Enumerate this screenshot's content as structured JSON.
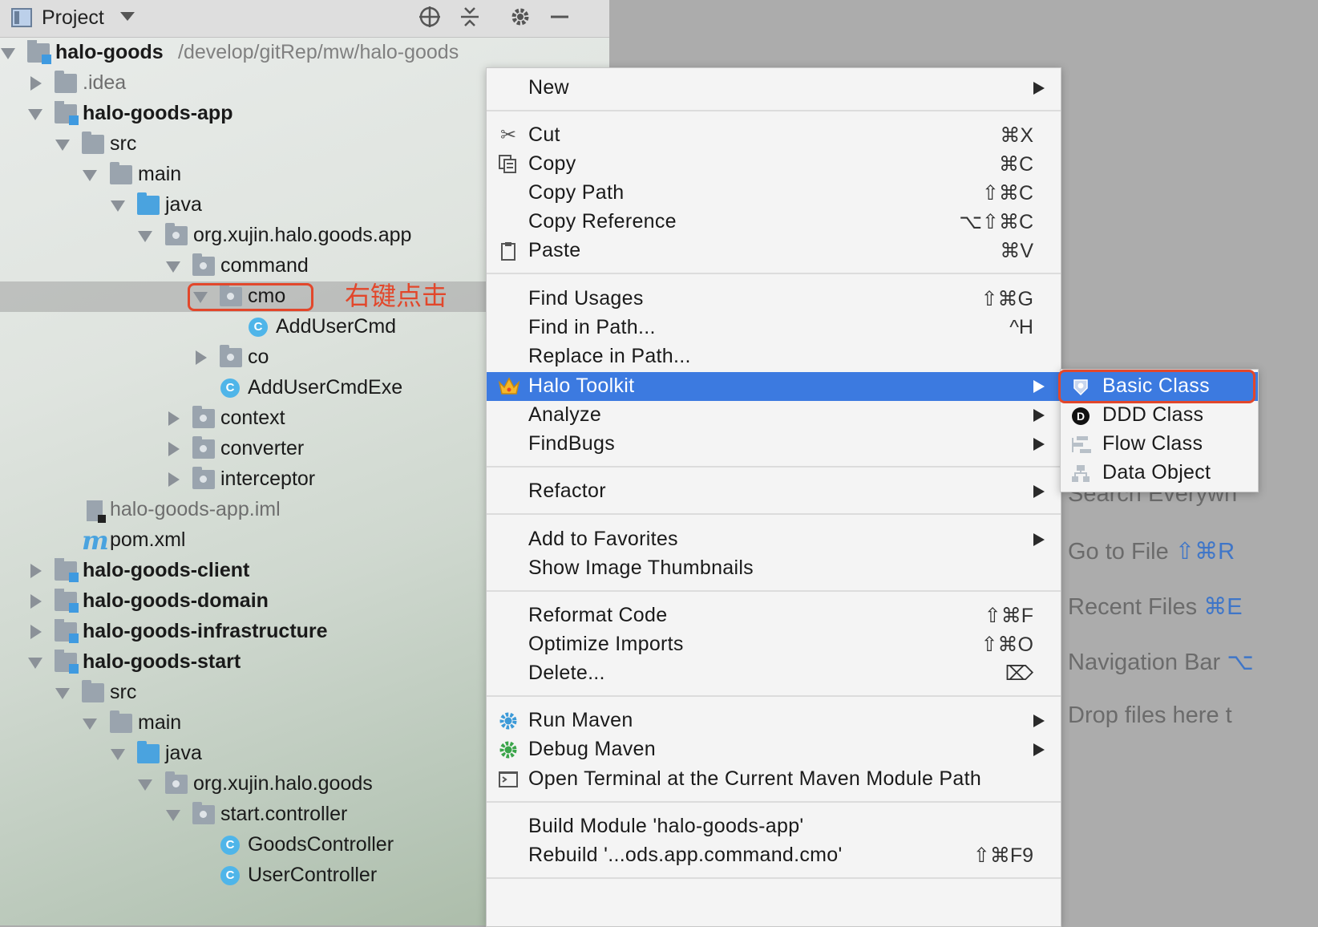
{
  "panel": {
    "title": "Project",
    "tools": [
      "crosshair-icon",
      "collapse-icon",
      "gear-icon",
      "minimize-icon"
    ]
  },
  "tree": {
    "root_name": "halo-goods",
    "root_path": "/develop/gitRep/mw/halo-goods",
    "idea": ".idea",
    "app_module": "halo-goods-app",
    "src": "src",
    "main": "main",
    "java": "java",
    "app_pkg": "org.xujin.halo.goods.app",
    "command": "command",
    "cmo": "cmo",
    "add_user_cmd": "AddUserCmd",
    "co": "co",
    "add_user_cmd_exe": "AddUserCmdExe",
    "context": "context",
    "converter": "converter",
    "interceptor": "interceptor",
    "iml": "halo-goods-app.iml",
    "pom": "pom.xml",
    "client": "halo-goods-client",
    "domain": "halo-goods-domain",
    "infrastructure": "halo-goods-infrastructure",
    "start": "halo-goods-start",
    "src2": "src",
    "main2": "main",
    "java2": "java",
    "start_pkg": "org.xujin.halo.goods",
    "start_controller": "start.controller",
    "goods_controller": "GoodsController",
    "user_controller": "UserController"
  },
  "annotation": "右键点击",
  "welcome": {
    "search": "Search Everywh",
    "goto_file": "Go to File",
    "goto_file_key": "⇧⌘R",
    "recent_files": "Recent Files",
    "recent_files_key": "⌘E",
    "nav_bar": "Navigation Bar",
    "nav_bar_key": "⌥",
    "drop": "Drop files here t"
  },
  "menu": {
    "new": "New",
    "cut": "Cut",
    "cut_sc": "⌘X",
    "copy": "Copy",
    "copy_sc": "⌘C",
    "copy_path": "Copy Path",
    "copy_path_sc": "⇧⌘C",
    "copy_ref": "Copy Reference",
    "copy_ref_sc": "⌥⇧⌘C",
    "paste": "Paste",
    "paste_sc": "⌘V",
    "find_usages": "Find Usages",
    "find_usages_sc": "⇧⌘G",
    "find_in_path": "Find in Path...",
    "find_in_path_sc": "^H",
    "replace_in_path": "Replace in Path...",
    "halo_toolkit": "Halo Toolkit",
    "analyze": "Analyze",
    "findbugs": "FindBugs",
    "refactor": "Refactor",
    "add_fav": "Add to Favorites",
    "show_thumbs": "Show Image Thumbnails",
    "reformat": "Reformat Code",
    "reformat_sc": "⇧⌘F",
    "optimize": "Optimize Imports",
    "optimize_sc": "⇧⌘O",
    "delete": "Delete...",
    "delete_sc": "⌦",
    "run_maven": "Run Maven",
    "debug_maven": "Debug Maven",
    "open_terminal": "Open Terminal at the Current Maven Module Path",
    "build_module": "Build Module 'halo-goods-app'",
    "rebuild": "Rebuild '...ods.app.command.cmo'",
    "rebuild_sc": "⇧⌘F9"
  },
  "submenu": {
    "basic_class": "Basic Class",
    "ddd_class": "DDD Class",
    "flow_class": "Flow Class",
    "data_object": "Data Object"
  },
  "colors": {
    "selection": "#3c7ae0",
    "highlight_box": "#e2472b",
    "annotation": "#e2472b"
  }
}
